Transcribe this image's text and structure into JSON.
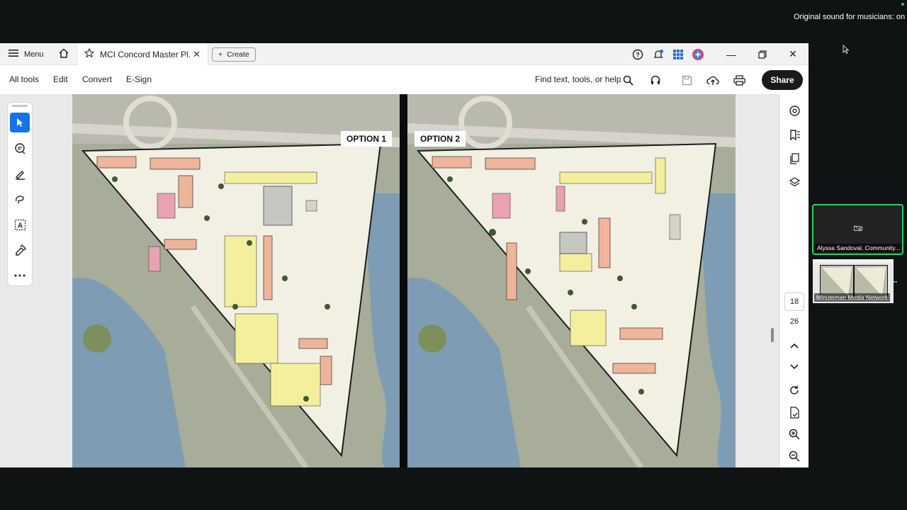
{
  "zoom": {
    "sound_notice": "Original sound for musicians: on",
    "participants": [
      {
        "name": "Alyssa Sandoval, Community..."
      },
      {
        "name": "Minuteman Media Network"
      }
    ]
  },
  "acrobat": {
    "tabbar": {
      "menu_label": "Menu",
      "tab_title": "MCI Concord Master Pl...",
      "create_label": "Create"
    },
    "toolbar": {
      "all_tools": "All tools",
      "edit": "Edit",
      "convert": "Convert",
      "esign": "E-Sign",
      "find_placeholder": "Find text, tools, or help",
      "share": "Share"
    },
    "document": {
      "option1_label": "OPTION 1",
      "option2_label": "OPTION 2",
      "current_page": "18",
      "total_pages": "26"
    },
    "colors": {
      "accent_blue": "#1473e6",
      "share_bg": "#1a1a1a",
      "active_speaker_border": "#23d160"
    }
  }
}
